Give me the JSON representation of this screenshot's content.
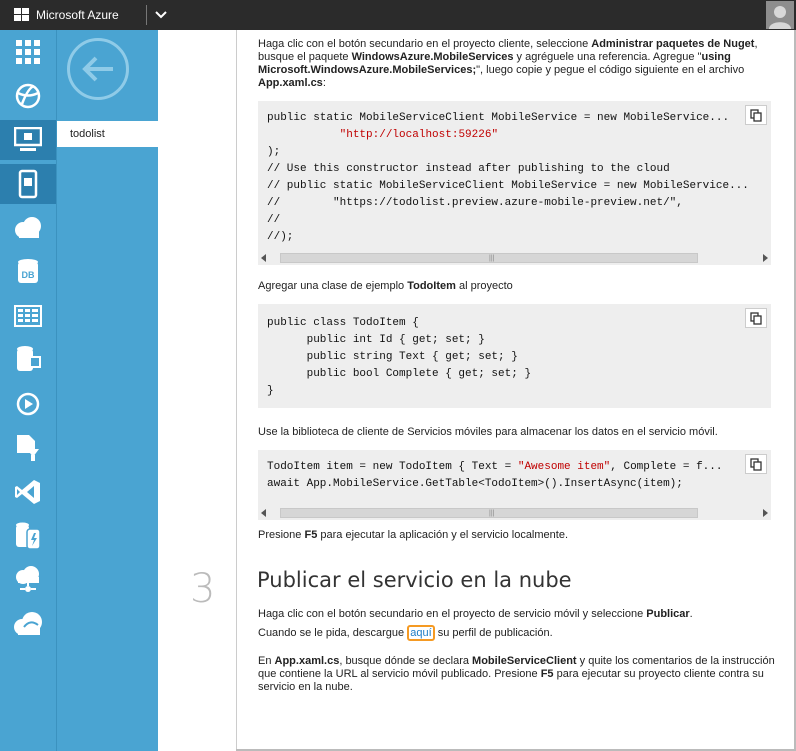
{
  "topbar": {
    "brand": "Microsoft Azure",
    "icons": {
      "logo": "windows-logo-icon",
      "dropdown": "chevron-down-icon",
      "user": "user-avatar-icon"
    }
  },
  "rail": {
    "items": [
      {
        "name": "all-items-icon"
      },
      {
        "name": "websites-icon"
      },
      {
        "name": "virtual-machines-icon"
      },
      {
        "name": "mobile-services-icon"
      },
      {
        "name": "cloud-services-icon"
      },
      {
        "name": "sql-databases-icon"
      },
      {
        "name": "storage-icon"
      },
      {
        "name": "hdinsight-icon"
      },
      {
        "name": "media-services-icon"
      },
      {
        "name": "service-bus-icon"
      },
      {
        "name": "visual-studio-online-icon"
      },
      {
        "name": "cache-icon"
      },
      {
        "name": "biztalk-services-icon"
      },
      {
        "name": "recovery-services-icon"
      }
    ]
  },
  "subnav": {
    "item": "todolist",
    "back_icon": "back-arrow-icon"
  },
  "content": {
    "intro": {
      "t1": "Haga clic con el botón secundario en el proyecto cliente, seleccione ",
      "b1": "Administrar paquetes de Nuget",
      "t2": ", busque el paquete ",
      "b2": "WindowsAzure.MobileServices",
      "t3": " y agréguele una referencia. Agregue \"",
      "b3": "using Microsoft.WindowsAzure.MobileServices;",
      "t4": "\", luego copie y pegue el código siguiente en el archivo ",
      "b4": "App.xaml.cs",
      "t5": ":"
    },
    "code1": {
      "l1": "public static MobileServiceClient MobileService = new MobileService...",
      "l2_indent": "           ",
      "l2_str": "\"http://localhost:59226\"",
      "l3": ");",
      "l4": "// Use this constructor instead after publishing to the cloud",
      "l5": "// public static MobileServiceClient MobileService = new MobileService...",
      "l6": "//        \"https://todolist.preview.azure-mobile-preview.net/\",",
      "l7": "//",
      "l8": "//);"
    },
    "p2": {
      "t1": "Agregar una clase de ejemplo ",
      "b1": "TodoItem",
      "t2": " al proyecto"
    },
    "code2": {
      "l1": "public class TodoItem {",
      "l2": "      public int Id { get; set; }",
      "l3": "      public string Text { get; set; }",
      "l4": "      public bool Complete { get; set; }",
      "l5": "}"
    },
    "p3": "Use la biblioteca de cliente de Servicios móviles para almacenar los datos en el servicio móvil.",
    "code3": {
      "l1a": "TodoItem item = new TodoItem { Text = ",
      "l1_str": "\"Awesome item\"",
      "l1b": ", Complete = f...",
      "l2": "await App.MobileService.GetTable<TodoItem>().InsertAsync(item);"
    },
    "p4": {
      "t1": "Presione ",
      "b1": "F5",
      "t2": " para ejecutar la aplicación y el servicio localmente."
    },
    "step": {
      "number": "3",
      "title": "Publicar el servicio en la nube"
    },
    "p5": {
      "t1": "Haga clic con el botón secundario en el proyecto de servicio móvil y seleccione ",
      "b1": "Publicar",
      "t2": "."
    },
    "p6": {
      "t1": "Cuando se le pida, descargue ",
      "link": "aquí",
      "t2": " su perfil de publicación."
    },
    "p7": {
      "t1": "En ",
      "b1": "App.xaml.cs",
      "t2": ", busque dónde se declara ",
      "b2": "MobileServiceClient",
      "t3": " y quite los comentarios de la instrucción que contiene la URL al servicio móvil publicado. Presione ",
      "b3": "F5",
      "t4": " para ejecutar su proyecto cliente contra su servicio en la nube."
    },
    "copy_icon": "copy-icon"
  },
  "colors": {
    "rail": "#4aa4d2",
    "rail_active": "#2c7fae",
    "topbar": "#2b2b2b",
    "string": "#c00000",
    "link": "#1e7bc4",
    "highlight": "#f59a23"
  }
}
